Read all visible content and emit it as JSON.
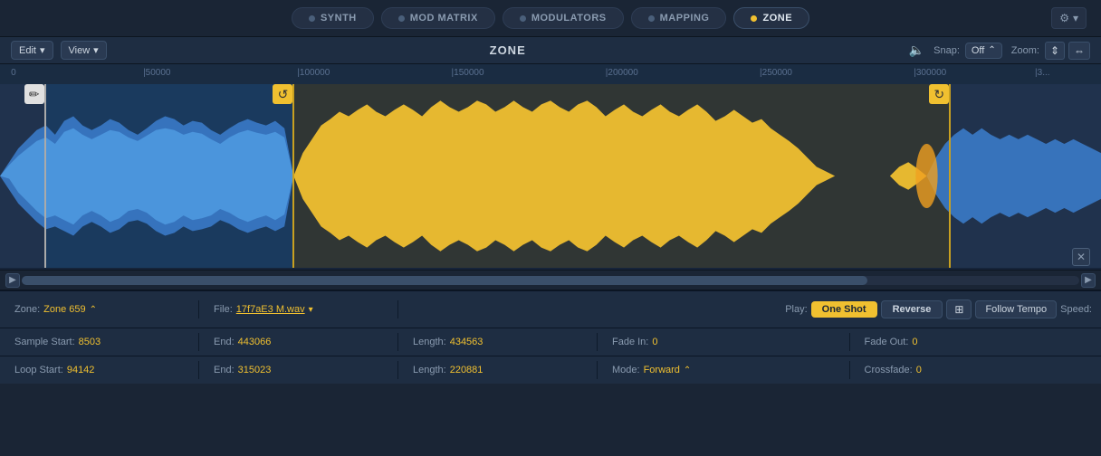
{
  "nav": {
    "tabs": [
      {
        "id": "synth",
        "label": "SYNTH",
        "dot_active": false
      },
      {
        "id": "mod-matrix",
        "label": "MOD MATRIX",
        "dot_active": false
      },
      {
        "id": "modulators",
        "label": "MODULATORS",
        "dot_active": false
      },
      {
        "id": "mapping",
        "label": "MAPPING",
        "dot_active": false
      },
      {
        "id": "zone",
        "label": "ZONE",
        "dot_active": true,
        "active": true
      }
    ],
    "gear_icon": "⚙",
    "chevron_icon": "▾"
  },
  "toolbar": {
    "edit_label": "Edit",
    "edit_chevron": "▾",
    "view_label": "View",
    "view_chevron": "▾",
    "title": "ZONE",
    "speaker_icon": "🔈",
    "snap_label": "Snap:",
    "snap_value": "Off",
    "snap_chevron": "⌃",
    "zoom_label": "Zoom:",
    "zoom_icon1": "⇕",
    "zoom_icon2": "⇔"
  },
  "ruler": {
    "markers": [
      {
        "label": "0",
        "pct": 0.01
      },
      {
        "label": "50000",
        "pct": 0.13
      },
      {
        "label": "100000",
        "pct": 0.27
      },
      {
        "label": "150000",
        "pct": 0.41
      },
      {
        "label": "200000",
        "pct": 0.55
      },
      {
        "label": "250000",
        "pct": 0.69
      },
      {
        "label": "300000",
        "pct": 0.83
      },
      {
        "label": "3...",
        "pct": 0.97
      }
    ]
  },
  "waveform": {
    "loop_start_pct": 0.266,
    "loop_end_pct": 0.862,
    "sample_start_pct": 0.04,
    "x_btn": "✕",
    "scroll_left": "◀",
    "scroll_right": "▶"
  },
  "zone_info": {
    "zone_label": "Zone:",
    "zone_value": "Zone 659",
    "zone_chevron": "⌃",
    "file_label": "File:",
    "file_value": "17f7aE3 M.wav",
    "file_chevron": "▾"
  },
  "play_controls": {
    "play_label": "Play:",
    "one_shot_label": "One Shot",
    "reverse_label": "Reverse",
    "link_icon": "⊞",
    "follow_tempo_label": "Follow Tempo",
    "speed_label": "Speed:"
  },
  "sample_info": {
    "start_label": "Sample Start:",
    "start_value": "8503",
    "end_label": "End:",
    "end_value": "443066",
    "length_label": "Length:",
    "length_value": "434563",
    "fade_in_label": "Fade In:",
    "fade_in_value": "0",
    "fade_out_label": "Fade Out:",
    "fade_out_value": "0"
  },
  "loop_info": {
    "start_label": "Loop Start:",
    "start_value": "94142",
    "end_label": "End:",
    "end_value": "315023",
    "length_label": "Length:",
    "length_value": "220881",
    "mode_label": "Mode:",
    "mode_value": "Forward",
    "mode_chevron": "⌃",
    "crossfade_label": "Crossfade:",
    "crossfade_value": "0"
  }
}
